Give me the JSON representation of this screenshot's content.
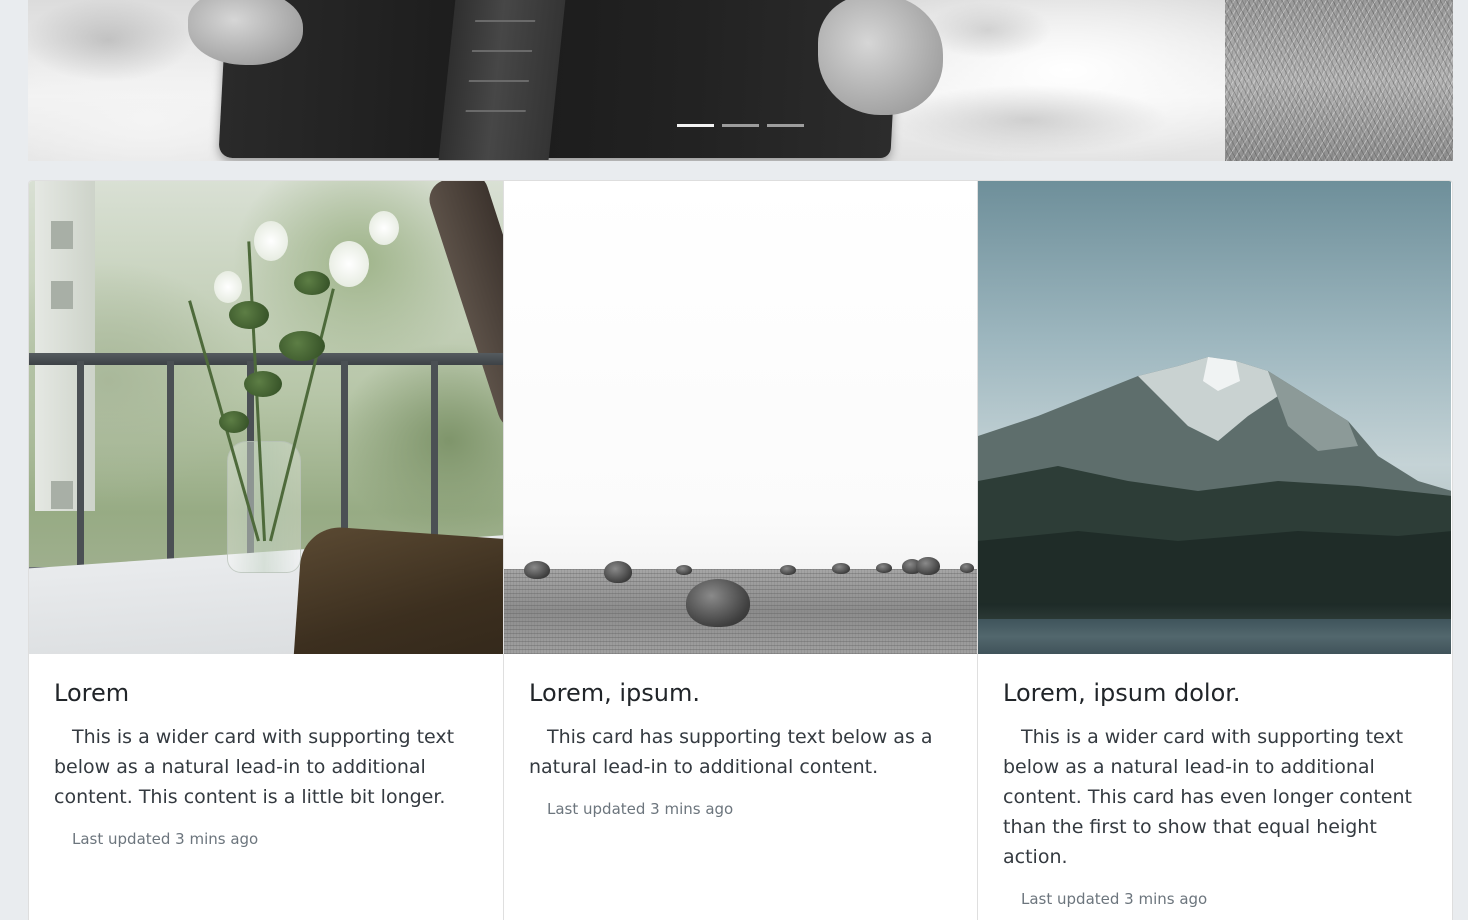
{
  "carousel": {
    "indicators": [
      {
        "label": "Slide 1",
        "active": true
      },
      {
        "label": "Slide 2",
        "active": false
      },
      {
        "label": "Slide 3",
        "active": false
      }
    ]
  },
  "cards": [
    {
      "title": "Lorem",
      "text": "This is a wider card with supporting text below as a natural lead-in to additional content. This content is a little bit longer.",
      "updated": "Last updated 3 mins ago",
      "image": "balcony-flowers-photo"
    },
    {
      "title": "Lorem, ipsum.",
      "text": "This card has supporting text below as a natural lead-in to additional content.",
      "updated": "Last updated 3 mins ago",
      "image": "hay-bales-field-photo"
    },
    {
      "title": "Lorem, ipsum dolor.",
      "text": "This is a wider card with supporting text below as a natural lead-in to additional content. This card has even longer content than the first to show that equal height action.",
      "updated": "Last updated 3 mins ago",
      "image": "mountain-lake-photo"
    }
  ],
  "colors": {
    "page_background": "#e9ecef",
    "title_text": "#212529",
    "body_text": "#343a40",
    "muted_text": "#6c757d"
  }
}
